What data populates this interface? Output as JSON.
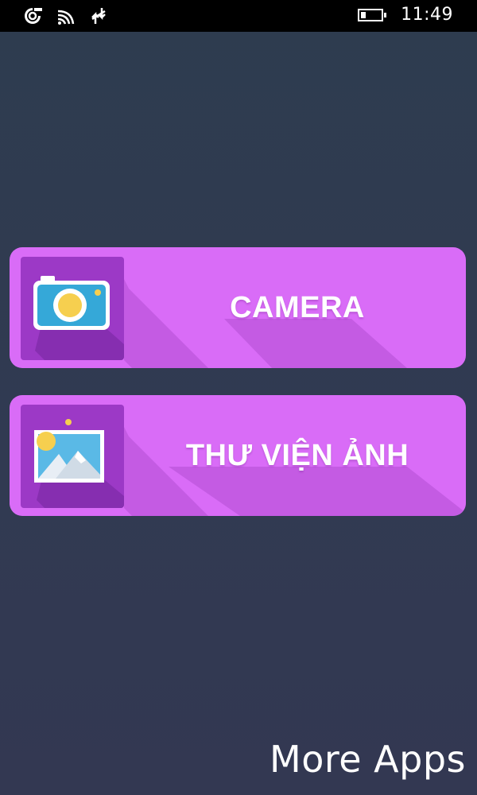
{
  "status_bar": {
    "time": "11:49",
    "icons": [
      "sync-icon",
      "wifi-icon",
      "data-transfer-icon",
      "battery-icon"
    ],
    "battery_level": 0.25
  },
  "menu": {
    "items": [
      {
        "label": "CAMERA",
        "icon": "camera-icon"
      },
      {
        "label": "THƯ VIỆN ẢNH",
        "icon": "picture-gallery-icon"
      }
    ]
  },
  "footer": {
    "more_apps_label": "More Apps"
  },
  "colors": {
    "background": "#2f3b4e",
    "button": "#d96cf7",
    "icon_tile": "#9c39c6",
    "camera_body": "#35a8d8",
    "camera_lens": "#f6cf4f"
  }
}
